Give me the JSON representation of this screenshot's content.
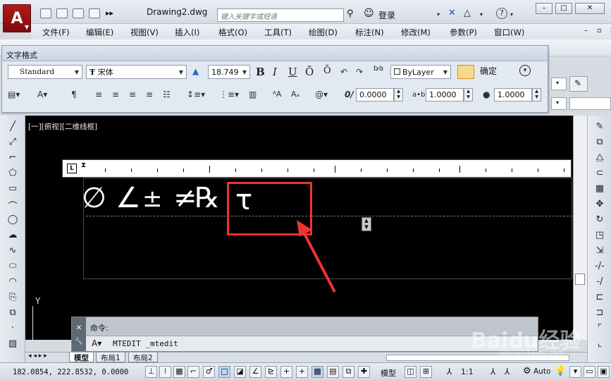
{
  "titlebar": {
    "app_logo": "A",
    "doc_title": "Drawing2.dwg",
    "search_placeholder": "键入关键字或短语",
    "login": "登录"
  },
  "menubar": {
    "items": [
      "文件(F)",
      "编辑(E)",
      "视图(V)",
      "插入(I)",
      "格式(O)",
      "工具(T)",
      "绘图(D)",
      "标注(N)",
      "修改(M)",
      "参数(P)",
      "窗口(W)"
    ]
  },
  "text_format": {
    "title": "文字格式",
    "style": "Standard",
    "font": "宋体",
    "height": "18.749",
    "bold": "B",
    "italic": "I",
    "underline": "U",
    "overline": "Ō",
    "color": "ByLayer",
    "ok": "确定",
    "oblique_value": "0.0000",
    "tracking_value": "1.0000",
    "width_value": "1.0000"
  },
  "canvas": {
    "view_label": "[一][俯视][二维线框]",
    "symbols": [
      "∅",
      "∠",
      "±",
      "≠",
      "℞"
    ],
    "highlighted_symbol": "τ",
    "ucs_y": "Y"
  },
  "command": {
    "prompt": "命令:",
    "input": "MTEDIT _mtedit"
  },
  "layout_tabs": [
    "模型",
    "布局1",
    "布局2"
  ],
  "statusbar": {
    "coords": "182.0854, 222.8532, 0.0000",
    "model": "模型",
    "scale": "1:1",
    "auto": "Auto"
  },
  "watermark": {
    "text": "Baidu经验",
    "sub": "jingyan.baidu.com"
  },
  "colors": {
    "highlight_box": "#ee3333",
    "canvas_bg": "#000000"
  }
}
